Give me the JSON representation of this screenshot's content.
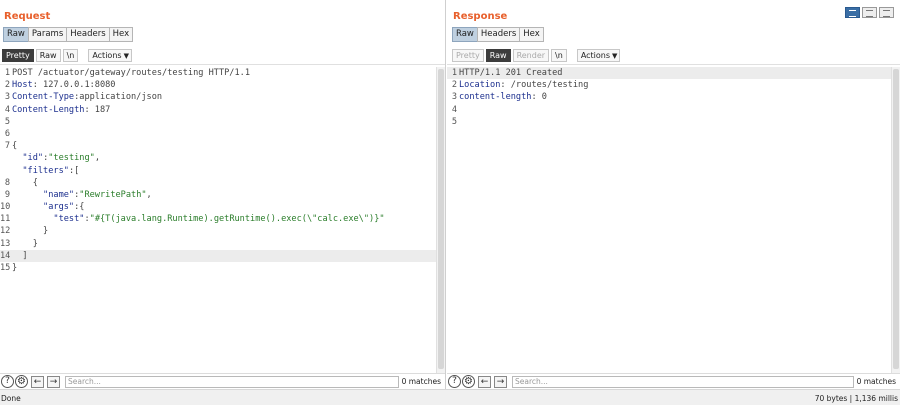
{
  "request": {
    "title": "Request",
    "tabs": [
      "Raw",
      "Params",
      "Headers",
      "Hex"
    ],
    "toolbar": {
      "pretty": "Pretty",
      "raw": "Raw",
      "newline": "\\n",
      "actions": "Actions"
    },
    "search": {
      "placeholder": "Search...",
      "matches": "0 matches"
    }
  },
  "response": {
    "title": "Response",
    "tabs": [
      "Raw",
      "Headers",
      "Hex"
    ],
    "toolbar": {
      "pretty": "Pretty",
      "raw": "Raw",
      "render": "Render",
      "newline": "\\n",
      "actions": "Actions"
    },
    "search": {
      "placeholder": "Search...",
      "matches": "0 matches"
    },
    "lines": [
      "HTTP/1.1 201 Created",
      "Location: /routes/testing",
      "content-length: 0",
      "",
      ""
    ]
  },
  "status": {
    "left": "Done",
    "right": "70 bytes | 1,136 millis"
  },
  "colors": {
    "accent": "#e8602c",
    "tab_active": "#bfd0e0",
    "keyword": "#1c2f8e",
    "string": "#2a7d2a"
  },
  "icons": [
    "help-icon",
    "settings-gear-icon",
    "arrow-left-icon",
    "arrow-right-icon",
    "layout-toggle-icon"
  ]
}
